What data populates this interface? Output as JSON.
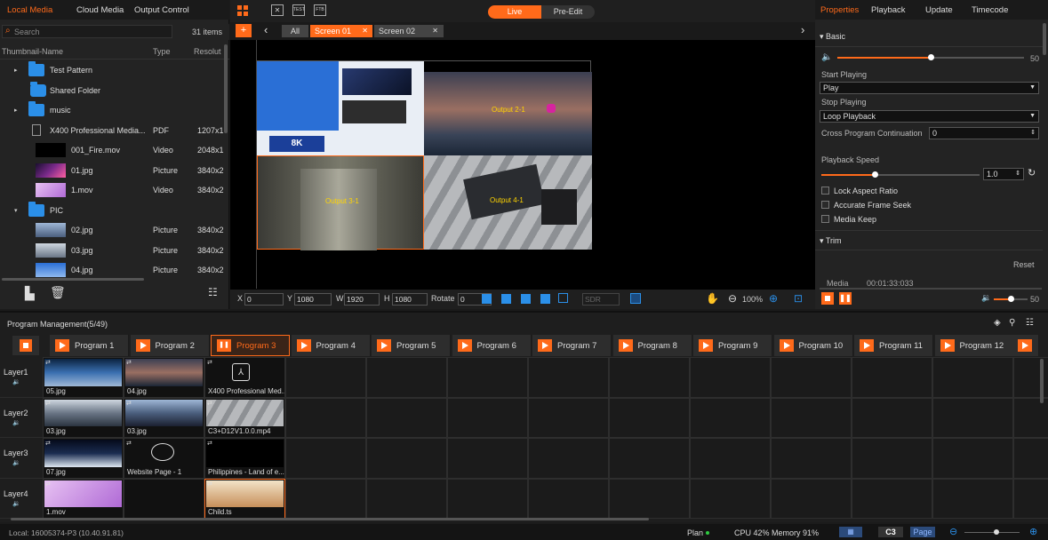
{
  "left_panel": {
    "tabs": [
      "Local Media",
      "Cloud Media",
      "Output Control"
    ],
    "search_placeholder": "Search",
    "item_count": "31 items",
    "columns": [
      "Thumbnail-Name",
      "Type",
      "Resolut"
    ],
    "rows": [
      {
        "name": "Test Pattern",
        "type": "",
        "res": "",
        "kind": "folder",
        "caret": "▸"
      },
      {
        "name": "Shared Folder",
        "type": "",
        "res": "",
        "kind": "shared",
        "caret": ""
      },
      {
        "name": "music",
        "type": "",
        "res": "",
        "kind": "folder",
        "caret": "▸"
      },
      {
        "name": "X400 Professional Media...",
        "type": "PDF",
        "res": "1207x1",
        "kind": "pdf",
        "caret": ""
      },
      {
        "name": "001_Fire.mov",
        "type": "Video",
        "res": "2048x1",
        "kind": "black",
        "caret": ""
      },
      {
        "name": "01.jpg",
        "type": "Picture",
        "res": "3840x2",
        "kind": "img1",
        "caret": ""
      },
      {
        "name": "1.mov",
        "type": "Video",
        "res": "3840x2",
        "kind": "img2",
        "caret": ""
      },
      {
        "name": "PIC",
        "type": "",
        "res": "",
        "kind": "folder",
        "caret": "▾"
      },
      {
        "name": "02.jpg",
        "type": "Picture",
        "res": "3840x2",
        "kind": "img3",
        "caret": ""
      },
      {
        "name": "03.jpg",
        "type": "Picture",
        "res": "3840x2",
        "kind": "img4",
        "caret": ""
      },
      {
        "name": "04.jpg",
        "type": "Picture",
        "res": "3840x2",
        "kind": "img5",
        "caret": ""
      }
    ]
  },
  "top_bar": {
    "live": "Live",
    "pre_edit": "Pre-Edit",
    "screen_tabs": [
      "All",
      "Screen 01",
      "Screen 02"
    ],
    "plus": "+",
    "back": "‹",
    "forward": "›"
  },
  "preview": {
    "labels": [
      "Output 2-1",
      "Output 3-1",
      "Output 4-1"
    ]
  },
  "bottom_toolbar": {
    "x_label": "X",
    "x_value": "0",
    "y_label": "Y",
    "y_value": "1080",
    "w_label": "W",
    "w_value": "1920",
    "h_label": "H",
    "h_value": "1080",
    "rotate_label": "Rotate",
    "rotate_value": "0",
    "sdr": "SDR",
    "zoom": "100%"
  },
  "properties": {
    "tabs": [
      "Properties",
      "Playback",
      "Update",
      "Timecode"
    ],
    "basic": "Basic",
    "volume": "50",
    "start_playing_label": "Start Playing",
    "start_playing_value": "Play",
    "stop_playing_label": "Stop Playing",
    "stop_playing_value": "Loop Playback",
    "cross_label": "Cross Program Continuation",
    "cross_value": "0",
    "speed_label": "Playback Speed",
    "speed_value": "1.0",
    "lock_aspect": "Lock Aspect Ratio",
    "accurate_seek": "Accurate Frame Seek",
    "media_keep": "Media Keep",
    "trim": "Trim",
    "reset": "Reset",
    "media_label": "Media",
    "media_time": "00:01:33:033",
    "bottom_volume": "50"
  },
  "program": {
    "title": "Program Management(5/49)",
    "tabs": [
      "Program 1",
      "Program 2",
      "Program 3",
      "Program 4",
      "Program 5",
      "Program 6",
      "Program 7",
      "Program 8",
      "Program 9",
      "Program 10",
      "Program 11",
      "Program 12"
    ],
    "layers": [
      "Layer1",
      "Layer2",
      "Layer3",
      "Layer4"
    ],
    "cells": [
      [
        "05.jpg",
        "04.jpg",
        "X400 Professional Med..."
      ],
      [
        "03.jpg",
        "03.jpg",
        "C3+D12V1.0.0.mp4"
      ],
      [
        "07.jpg",
        "Website Page - 1",
        "Philippines - Land of e..."
      ],
      [
        "1.mov",
        "",
        "Child.ts"
      ]
    ]
  },
  "status": {
    "local": "Local: 16005374-P3 (10.40.91.81)",
    "plan": "Plan",
    "cpu": "CPU 42% Memory 91%",
    "c3": "C3",
    "page": "Page"
  },
  "colors": {
    "accent": "#ff6a1a",
    "folder": "#2b8fe8",
    "bg": "#1b1b1b"
  }
}
